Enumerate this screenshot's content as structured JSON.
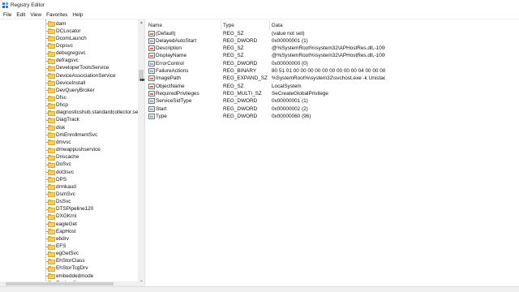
{
  "window": {
    "title": "Registry Editor"
  },
  "menu": [
    "File",
    "Edit",
    "View",
    "Favorites",
    "Help"
  ],
  "tree": {
    "items": [
      "dam",
      "DCLocator",
      "DcomLaunch",
      "Dcpsvc",
      "debugregsvc",
      "defragsvc",
      "DeveloperToolsService",
      "DeviceAssociationService",
      "DeviceInstall",
      "DevQueryBroker",
      "Dfsc",
      "Dhcp",
      "diagnosticshub.standardcollector.serv",
      "DiagTrack",
      "disk",
      "DmEnrollmentSvc",
      "dmvsc",
      "dmwappushservice",
      "Dnscache",
      "DoSvc",
      "dot3svc",
      "DPS",
      "drmkaud",
      "DsmSvc",
      "DsSvc",
      "DTSPipeline120",
      "DXGKrnl",
      "eagleGet",
      "EapHost",
      "ebdrv",
      "EFS",
      "egGetSvc",
      "EhStorClass",
      "EhStorTcgDrv",
      "embeddedmode",
      "EntAppSvc"
    ]
  },
  "values_pane": {
    "columns": {
      "name": "Name",
      "type": "Type",
      "data": "Data"
    },
    "rows": [
      {
        "icon": "string-value-icon",
        "name": "(Default)",
        "type": "REG_SZ",
        "data": "(value not set)"
      },
      {
        "icon": "binary-value-icon",
        "name": "DelayedAutoStart",
        "type": "REG_DWORD",
        "data": "0x00000001 (1)"
      },
      {
        "icon": "string-value-icon",
        "name": "Description",
        "type": "REG_SZ",
        "data": "@%SystemRoot%\\system32\\APHostRes.dll,-10001"
      },
      {
        "icon": "string-value-icon",
        "name": "DisplayName",
        "type": "REG_SZ",
        "data": "@%SystemRoot%\\system32\\APHostRes.dll,-10002"
      },
      {
        "icon": "binary-value-icon",
        "name": "ErrorControl",
        "type": "REG_DWORD",
        "data": "0x00000000 (0)"
      },
      {
        "icon": "binary-value-icon",
        "name": "FailureActions",
        "type": "REG_BINARY",
        "data": "80 51 01 00 00 00 00 00 00 00 00 00 04 00 00 00 14 0..."
      },
      {
        "icon": "string-value-icon",
        "name": "ImagePath",
        "type": "REG_EXPAND_SZ",
        "data": "%SystemRoot%\\system32\\svchost.exe -k Unistack..."
      },
      {
        "icon": "string-value-icon",
        "name": "ObjectName",
        "type": "REG_SZ",
        "data": "LocalSystem"
      },
      {
        "icon": "string-value-icon",
        "name": "RequiredPrivileges",
        "type": "REG_MULTI_SZ",
        "data": "SeCreateGlobalPrivilege"
      },
      {
        "icon": "binary-value-icon",
        "name": "ServiceSidType",
        "type": "REG_DWORD",
        "data": "0x00000001 (1)"
      },
      {
        "icon": "binary-value-icon",
        "name": "Start",
        "type": "REG_DWORD",
        "data": "0x00000002 (2)"
      },
      {
        "icon": "binary-value-icon",
        "name": "Type",
        "type": "REG_DWORD",
        "data": "0x00000060 (96)"
      }
    ]
  },
  "icons": {
    "string_glyph": "ab",
    "binary_glyph": "01",
    "scroll_up": "▲",
    "scroll_down": "▼",
    "resize_cursor": "⇹"
  },
  "colors": {
    "folder_fill": "#f4cf5e",
    "folder_border": "#d7a93e",
    "string_icon": "#b22222",
    "binary_icon": "#1a5fb4"
  }
}
